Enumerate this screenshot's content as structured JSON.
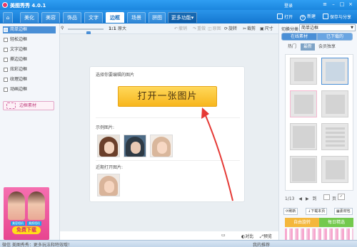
{
  "app": {
    "title": "美图秀秀 4.0.1",
    "login": "登录",
    "menu_icon": "menu-icon",
    "minimize_icon": "minimize-icon",
    "maximize_icon": "maximize-icon",
    "close_icon": "close-icon"
  },
  "nav": {
    "tabs": [
      {
        "label": "美化"
      },
      {
        "label": "美容"
      },
      {
        "label": "饰品"
      },
      {
        "label": "文字"
      },
      {
        "label": "边框"
      },
      {
        "label": "场景"
      },
      {
        "label": "拼图"
      }
    ],
    "active_tab": "边框",
    "more": "更多功能",
    "open": "打开",
    "new": "新建",
    "save_share": "保存与分享"
  },
  "toolbar": {
    "ratio": "1:1",
    "fit": "原大",
    "undo": "撤销",
    "redo": "重做",
    "original": "原图",
    "rotate": "旋转",
    "crop": "裁剪",
    "resize": "尺寸"
  },
  "zoom": {
    "level": 0.6
  },
  "left_sidebar": {
    "items": [
      {
        "label": "简单边框"
      },
      {
        "label": "轻松边框"
      },
      {
        "label": "文字边框"
      },
      {
        "label": "撕边边框"
      },
      {
        "label": "炫彩边框"
      },
      {
        "label": "纹理边框"
      },
      {
        "label": "动画边框"
      }
    ],
    "active_index": 0,
    "border_package": "边框素材",
    "ad_tag_1": "美容相机",
    "ad_tag_2": "美颜相机",
    "ad_button": "免费下载"
  },
  "main": {
    "choose_prompt": "选择你要编辑的图片",
    "open_button": "打开一张图片",
    "examples_label": "示例图片:",
    "recent_label": "近期打开图片:"
  },
  "right_sidebar": {
    "category_label": "切换分类",
    "category_value": "简单边框",
    "tab_online": "在线素材",
    "tab_downloaded": "已下载的",
    "filters": [
      "热门",
      "最新",
      "会员独享"
    ],
    "active_filter": "最新",
    "page_current": "1/13",
    "page_jump_label": "到",
    "page_unit": "页",
    "refresh": "刷新",
    "download_more": "下载本页",
    "library": "素材包",
    "banner_1": "自由旋转",
    "banner_2": "每日精选"
  },
  "bottom_bar": {
    "compare": "对比",
    "preview": "预览"
  },
  "status": {
    "left": "微信 美图秀秀：更多玩法和特效哦！",
    "right": "我的推荐"
  }
}
